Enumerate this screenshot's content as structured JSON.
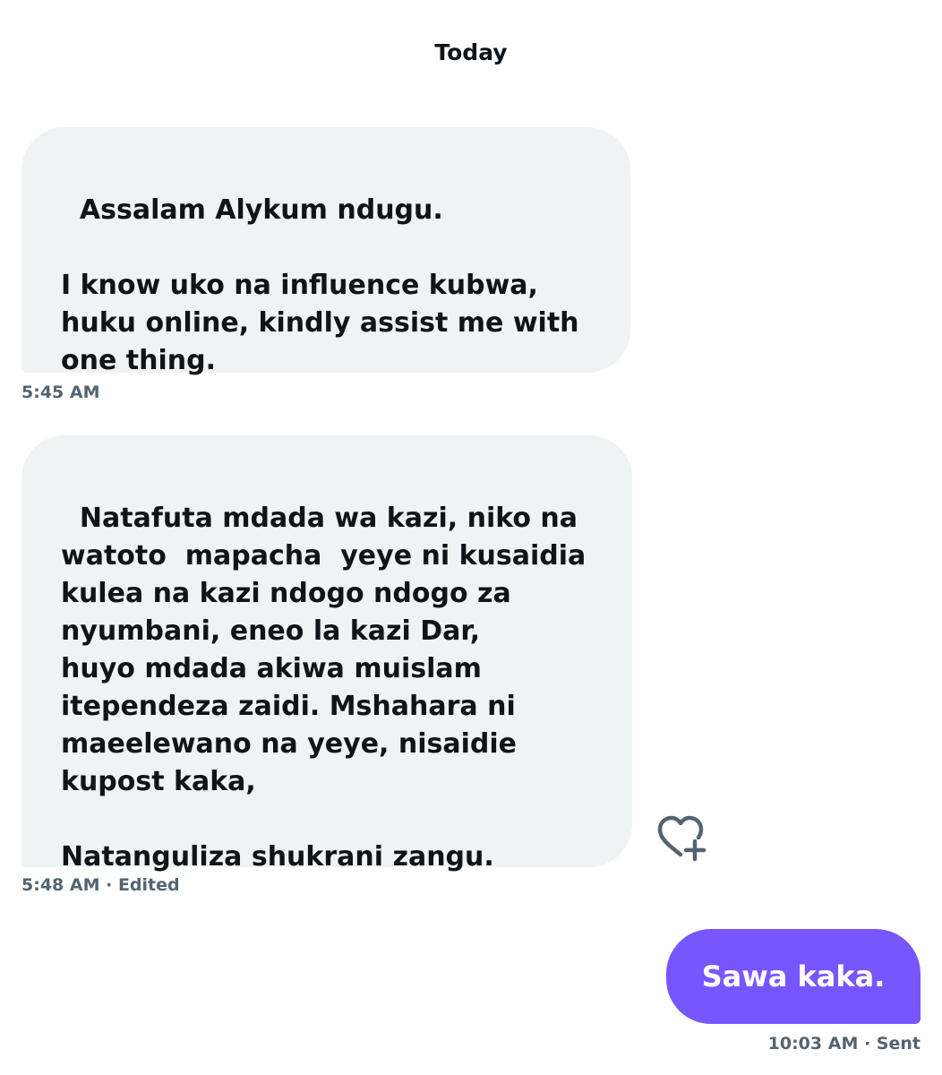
{
  "conversation": {
    "day_label": "Today",
    "messages": [
      {
        "direction": "incoming",
        "text": "Assalam Alykum ndugu.\n\nI know uko na influence kubwa,\nhuku online, kindly assist me with\none thing.",
        "time": "5:45 AM",
        "status": ""
      },
      {
        "direction": "incoming",
        "text": "Natafuta mdada wa kazi, niko na\nwatoto  mapacha  yeye ni kusaidia\nkulea na kazi ndogo ndogo za\nnyumbani, eneo la kazi Dar,\nhuyo mdada akiwa muislam\nitependeza zaidi. Mshahara ni\nmaeelewano na yeye, nisaidie\nkupost kaka,\n\nNatanguliza shukrani zangu.",
        "time": "5:48 AM",
        "status": "· Edited"
      },
      {
        "direction": "outgoing",
        "text": "Sawa kaka.",
        "time": "10:03 AM",
        "status": " · Sent"
      }
    ],
    "reaction_icon": "heart-plus-icon"
  },
  "colors": {
    "incoming_bubble": "#eff3f4",
    "outgoing_bubble": "#7856ff",
    "meta_text": "#536471",
    "primary_text": "#0f1419"
  }
}
